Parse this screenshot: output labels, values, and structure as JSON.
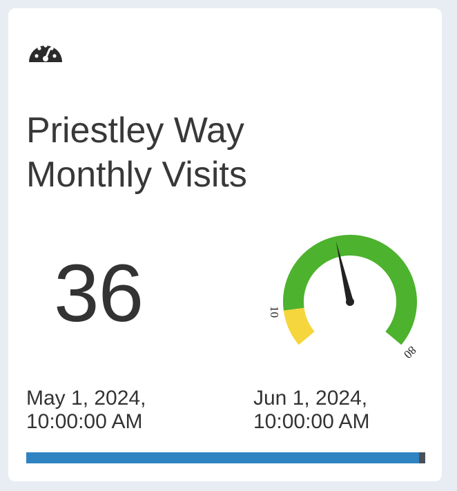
{
  "card": {
    "icon": "tachometer-icon",
    "title_line1": "Priestley Way",
    "title_line2": "Monthly Visits",
    "value": "36",
    "start_label_line1": "May 1, 2024,",
    "start_label_line2": "10:00:00 AM",
    "end_label_line1": "Jun 1, 2024,",
    "end_label_line2": "10:00:00 AM",
    "progress_fraction": 0.985
  },
  "gauge": {
    "min": 0,
    "max": 80,
    "value": 36,
    "threshold": 10,
    "threshold_label": "10",
    "max_label": "80",
    "low_color": "#f5d63d",
    "high_color": "#4db22d",
    "needle_color": "#222222"
  },
  "colors": {
    "background": "#e8edf3",
    "card": "#ffffff",
    "text": "#333333",
    "progress_fill": "#2f83c1",
    "progress_track": "#4a5058"
  }
}
